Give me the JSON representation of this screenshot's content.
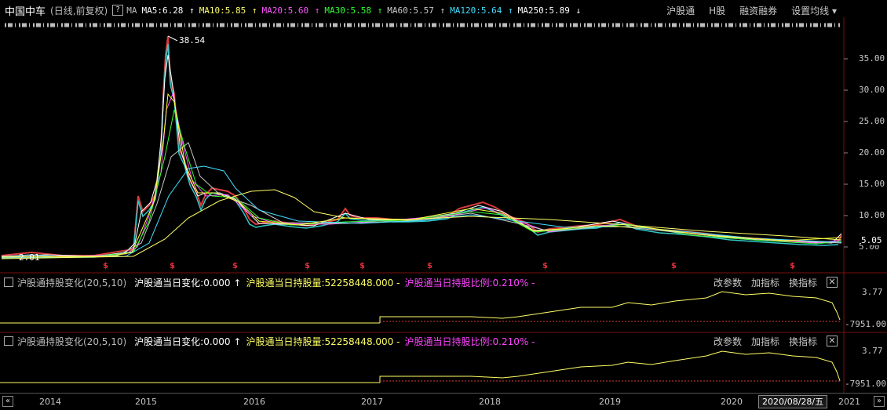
{
  "header": {
    "title": "中国中车",
    "subtitle": "(日线,前复权)",
    "q_label": "?",
    "ma_label": "MA",
    "ma": [
      {
        "label": "MA5:6.28",
        "arrow": "↑",
        "color": "#ffffff"
      },
      {
        "label": "MA10:5.85",
        "arrow": "↑",
        "color": "#ffff66"
      },
      {
        "label": "MA20:5.60",
        "arrow": "↑",
        "color": "#ff55ff"
      },
      {
        "label": "MA30:5.58",
        "arrow": "↑",
        "color": "#33ff33"
      },
      {
        "label": "MA60:5.57",
        "arrow": "↑",
        "color": "#c8c8c8"
      },
      {
        "label": "MA120:5.64",
        "arrow": "↑",
        "color": "#44ddff"
      },
      {
        "label": "MA250:5.89",
        "arrow": "↓",
        "color": "#ffffff"
      }
    ],
    "right_links": [
      "沪股通",
      "H股",
      "融资融券",
      "设置均线 ▾"
    ]
  },
  "price_chart": {
    "peak_label": "38.54",
    "low_label": "2.01",
    "current_price": "5.05",
    "axis_labels": [
      "35.00",
      "30.00",
      "25.00",
      "20.00",
      "15.00",
      "10.00",
      "5.00"
    ],
    "marker_glyph": "$"
  },
  "panels": [
    {
      "name": "沪股通持股变化(20,5,10)",
      "items": [
        {
          "text": "沪股通当日变化:0.000 ↑",
          "color": "#ffffff"
        },
        {
          "text": "沪股通当日持股量:52258448.000 -",
          "color": "#ffff66"
        },
        {
          "text": "沪股通当日持股比例:0.210% -",
          "color": "#ff44ff"
        }
      ],
      "actions": [
        "改参数",
        "加指标",
        "换指标"
      ],
      "close": "✕",
      "top_label": "3.77",
      "bottom_label": "-7951.00"
    },
    {
      "name": "沪股通持股变化(20,5,10)",
      "items": [
        {
          "text": "沪股通当日变化:0.000 ↑",
          "color": "#ffffff"
        },
        {
          "text": "沪股通当日持股量:52258448.000 -",
          "color": "#ffff66"
        },
        {
          "text": "沪股通当日持股比例:0.210% -",
          "color": "#ff44ff"
        }
      ],
      "actions": [
        "改参数",
        "加指标",
        "换指标"
      ],
      "close": "✕",
      "top_label": "3.77",
      "bottom_label": "-7951.00"
    }
  ],
  "xaxis": {
    "years": [
      "2014",
      "2015",
      "2016",
      "2017",
      "2018",
      "2019",
      "2020",
      "2021"
    ],
    "date_box": "2020/08/28/五",
    "nav_prev": "«",
    "nav_next": "»"
  }
}
